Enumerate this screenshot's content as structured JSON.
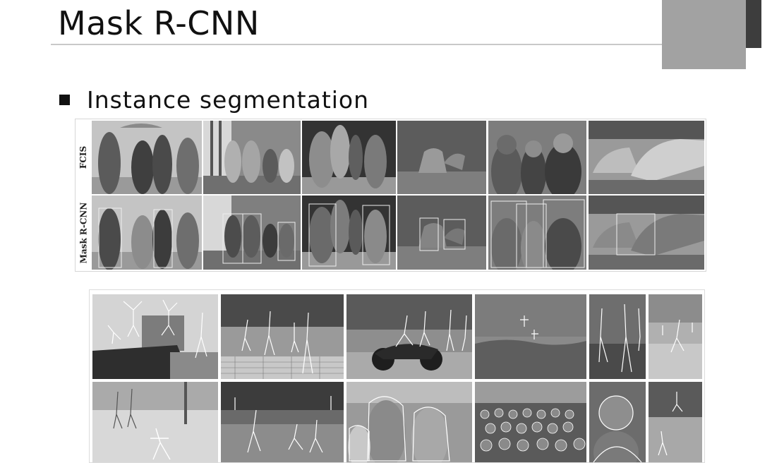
{
  "slide": {
    "title": "Mask R-CNN",
    "bullet": "Instance segmentation"
  },
  "comparison": {
    "row_labels": [
      "FCIS",
      "Mask R-CNN"
    ],
    "fcis_scenes": [
      "umbrella-people",
      "bench-group",
      "runners",
      "animals-field",
      "three-people-portrait",
      "trains"
    ],
    "maskrcnn_scenes": [
      "umbrella-people",
      "bench-group",
      "runners",
      "animals-field",
      "three-people-portrait",
      "trains"
    ]
  },
  "examples": {
    "scenes": [
      "jumping-people",
      "tennis-players",
      "motorcycle-riders",
      "surfers",
      "kitchen-people",
      "beach-people",
      "skier",
      "baseball",
      "girls-with-bottles",
      "crowded-hall",
      "child-portrait",
      "sports-field"
    ]
  },
  "colors": {
    "deco_dark": "#3d3d3d",
    "deco_gray": "#a2a2a2",
    "title_rule": "#c9c9c9"
  }
}
